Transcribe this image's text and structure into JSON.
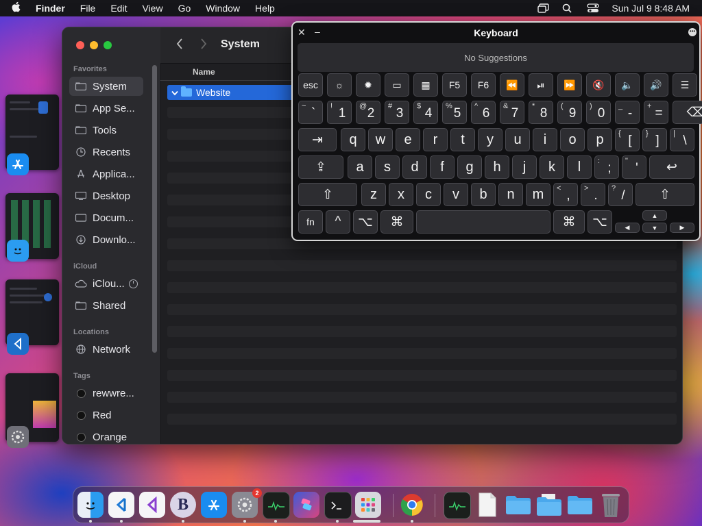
{
  "menubar": {
    "app": "Finder",
    "items": [
      "File",
      "Edit",
      "View",
      "Go",
      "Window",
      "Help"
    ],
    "clock": "Sun Jul 9  8:48 AM"
  },
  "finder": {
    "toolbar_title": "System",
    "column_name": "Name",
    "selected_item": "Website",
    "sections": {
      "favorites": "Favorites",
      "icloud": "iCloud",
      "locations": "Locations",
      "tags": "Tags"
    },
    "favorites": [
      "System",
      "App Se...",
      "Tools",
      "Recents",
      "Applica...",
      "Desktop",
      "Docum...",
      "Downlo..."
    ],
    "icloud": [
      "iClou...",
      "Shared"
    ],
    "locations": [
      "Network"
    ],
    "tags": [
      "rewwre...",
      "Red",
      "Orange"
    ],
    "icons": {
      "folder": "folder-icon",
      "recents": "clock-icon",
      "applications": "apps-icon",
      "desktop": "desktop-icon",
      "documents": "document-icon",
      "downloads": "download-icon",
      "icloud": "cloud-icon",
      "shared": "shared-folder-icon",
      "network": "globe-icon"
    }
  },
  "keyboard": {
    "title": "Keyboard",
    "suggestions": "No Suggestions",
    "fn_keys": [
      "esc",
      "☼",
      "✹",
      "▭",
      "▦",
      "F5",
      "F6",
      "⏪",
      "⏯",
      "⏩",
      "🔇",
      "🔈",
      "🔊",
      "☰"
    ],
    "row_num": [
      [
        "~",
        "`"
      ],
      [
        "!",
        "1"
      ],
      [
        "@",
        "2"
      ],
      [
        "#",
        "3"
      ],
      [
        "$",
        "4"
      ],
      [
        "%",
        "5"
      ],
      [
        "^",
        "6"
      ],
      [
        "&",
        "7"
      ],
      [
        "*",
        "8"
      ],
      [
        "(",
        "9"
      ],
      [
        ")",
        "0"
      ],
      [
        "_",
        "-"
      ],
      [
        "+",
        "="
      ]
    ],
    "row_q": [
      "q",
      "w",
      "e",
      "r",
      "t",
      "y",
      "u",
      "i",
      "o",
      "p"
    ],
    "row_q_sym": [
      [
        "{",
        "["
      ],
      [
        "}",
        "]"
      ],
      [
        "|",
        "\\"
      ]
    ],
    "row_a": [
      "a",
      "s",
      "d",
      "f",
      "g",
      "h",
      "j",
      "k",
      "l"
    ],
    "row_a_sym": [
      [
        ":",
        ";"
      ],
      [
        "\"",
        "'"
      ]
    ],
    "row_z": [
      "z",
      "x",
      "c",
      "v",
      "b",
      "n",
      "m"
    ],
    "row_z_sym": [
      [
        "<",
        ","
      ],
      [
        ">",
        "."
      ],
      [
        "?",
        "/"
      ]
    ],
    "mods": {
      "tab": "⇥",
      "caps": "⇪",
      "shift": "⇧",
      "return": "↩",
      "delete": "⌫",
      "fn": "fn",
      "ctrl": "^",
      "opt": "⌥",
      "cmd": "⌘"
    },
    "arrows": {
      "up": "▲",
      "down": "▼",
      "left": "◀",
      "right": "▶"
    }
  },
  "dock": {
    "badge_settings": "2",
    "bbedit_letter": "B"
  }
}
